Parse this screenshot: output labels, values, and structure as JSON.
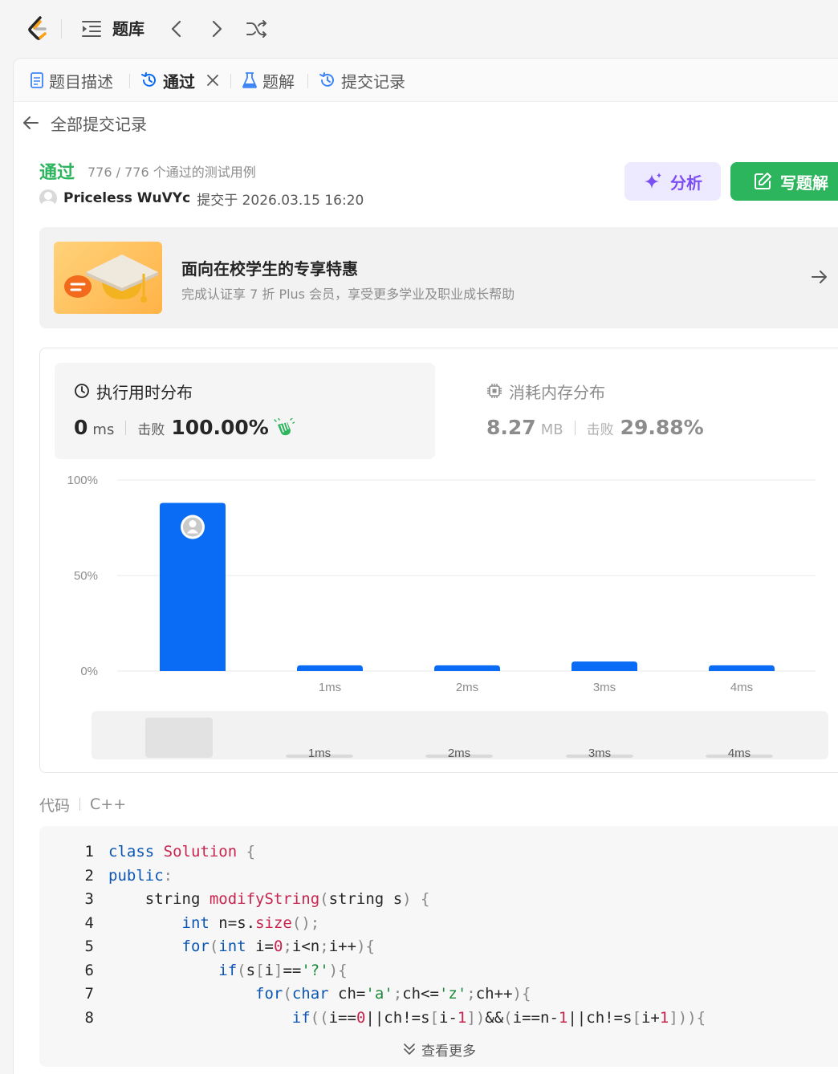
{
  "nav": {
    "title": "题库"
  },
  "tabs": [
    {
      "label": "题目描述",
      "icon": "document-icon"
    },
    {
      "label": "通过",
      "icon": "history-icon",
      "active": true,
      "closable": true
    },
    {
      "label": "题解",
      "icon": "flask-icon"
    },
    {
      "label": "提交记录",
      "icon": "history-icon"
    }
  ],
  "back": {
    "label": "全部提交记录"
  },
  "submission": {
    "status": "通过",
    "tests": "776 / 776 个通过的测试用例",
    "user": "Priceless WuVYc",
    "submitted": "提交于 2026.03.15 16:20",
    "status_color": "#2db55d"
  },
  "actions": {
    "analyze": "分析",
    "write": "写题解"
  },
  "promo": {
    "title": "面向在校学生的专享特惠",
    "subtitle": "完成认证享 7 折 Plus 会员，享受更多学业及职业成长帮助"
  },
  "runtime": {
    "title": "执行用时分布",
    "value": "0",
    "unit": "ms",
    "beat_label": "击败",
    "beat": "100.00%"
  },
  "memory": {
    "title": "消耗内存分布",
    "value": "8.27",
    "unit": "MB",
    "beat_label": "击败",
    "beat": "29.88%"
  },
  "chart_data": {
    "type": "bar",
    "categories": [
      "",
      "1ms",
      "2ms",
      "3ms",
      "4ms"
    ],
    "values": [
      88,
      3,
      3,
      5,
      3
    ],
    "ylim": [
      0,
      100
    ],
    "yticks": [
      "0%",
      "50%",
      "100%"
    ],
    "bar_color": "#0a6cf5",
    "highlight_index": 0,
    "grid": true
  },
  "code": {
    "label": "代码",
    "language": "C++",
    "more": "查看更多",
    "lines": [
      "class Solution {",
      "public:",
      "    string modifyString(string s) {",
      "        int n=s.size();",
      "        for(int i=0;i<n;i++){",
      "            if(s[i]=='?'){",
      "                for(char ch='a';ch<='z';ch++){",
      "                    if((i==0||ch!=s[i-1])&&(i==n-1||ch!=s[i+1])){"
    ]
  }
}
